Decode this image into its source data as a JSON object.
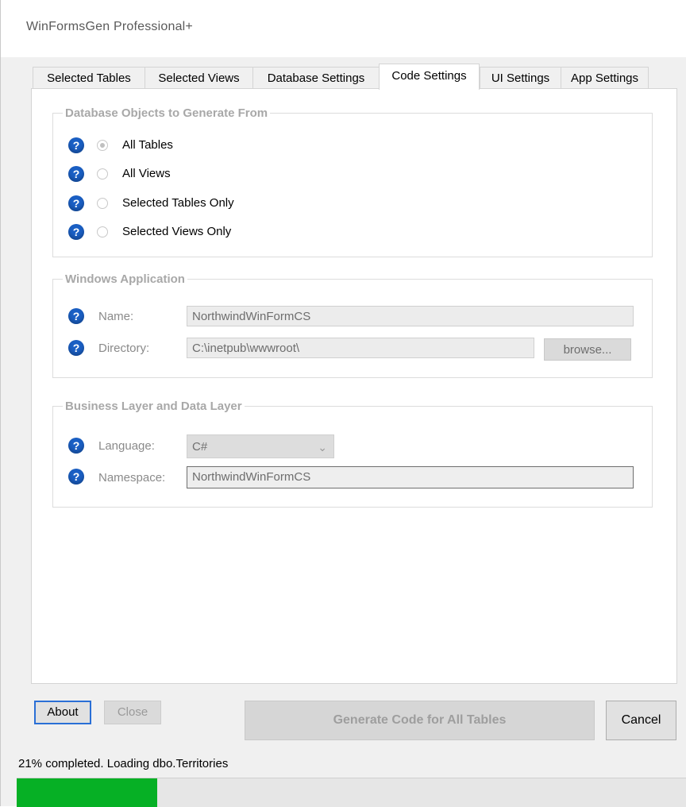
{
  "window": {
    "title": "WinFormsGen Professional+"
  },
  "tabs": [
    {
      "label": "Selected Tables",
      "active": false
    },
    {
      "label": "Selected Views",
      "active": false
    },
    {
      "label": "Database Settings",
      "active": false
    },
    {
      "label": "Code Settings",
      "active": true
    },
    {
      "label": "UI Settings",
      "active": false
    },
    {
      "label": "App Settings",
      "active": false
    }
  ],
  "db_objects": {
    "legend": "Database Objects to Generate From",
    "options": [
      {
        "label": "All Tables",
        "checked": true
      },
      {
        "label": "All Views",
        "checked": false
      },
      {
        "label": "Selected Tables Only",
        "checked": false
      },
      {
        "label": "Selected Views Only",
        "checked": false
      }
    ]
  },
  "windows_app": {
    "legend": "Windows Application",
    "name_label": "Name:",
    "name_value": "NorthwindWinFormCS",
    "directory_label": "Directory:",
    "directory_value": "C:\\inetpub\\wwwroot\\",
    "browse_label": "browse..."
  },
  "business_layer": {
    "legend": "Business Layer and Data Layer",
    "language_label": "Language:",
    "language_value": "C#",
    "namespace_label": "Namespace:",
    "namespace_value": "NorthwindWinFormCS"
  },
  "help_glyph": "?",
  "buttons": {
    "about": "About",
    "close": "Close",
    "generate": "Generate Code for All Tables",
    "cancel": "Cancel"
  },
  "status": {
    "text": "21% completed.  Loading dbo.Territories",
    "progress_fraction": 0.21
  },
  "colors": {
    "progress_fill": "#06b025",
    "help_icon": "#1a5fc4"
  }
}
